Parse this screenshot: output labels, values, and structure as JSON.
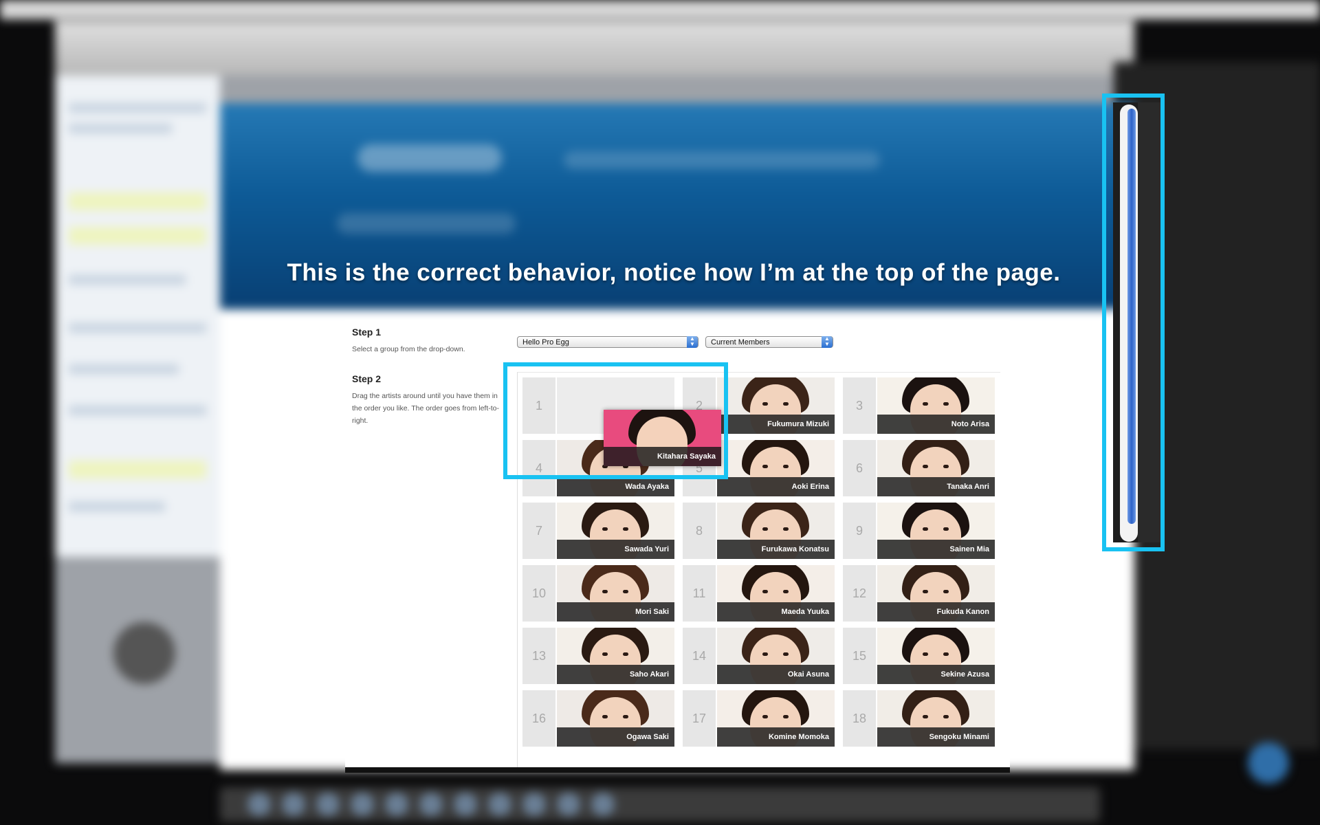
{
  "caption": "This is the correct behavior, notice how I’m at the top of the page.",
  "steps": {
    "step1": {
      "title": "Step 1",
      "text": "Select a group from the drop-down."
    },
    "step2": {
      "title": "Step 2",
      "text": "Drag the artists around until you have them in the order you like. The order goes from left-to-right."
    }
  },
  "selects": {
    "group": "Hello Pro Egg",
    "members": "Current Members"
  },
  "dragged": {
    "name": "Kitahara Sayaka"
  },
  "slots": [
    {
      "num": "1",
      "name": ""
    },
    {
      "num": "2",
      "name": "Fukumura Mizuki"
    },
    {
      "num": "3",
      "name": "Noto Arisa"
    },
    {
      "num": "4",
      "name": "Wada Ayaka"
    },
    {
      "num": "5",
      "name": "Aoki Erina"
    },
    {
      "num": "6",
      "name": "Tanaka Anri"
    },
    {
      "num": "7",
      "name": "Sawada Yuri"
    },
    {
      "num": "8",
      "name": "Furukawa Konatsu"
    },
    {
      "num": "9",
      "name": "Sainen Mia"
    },
    {
      "num": "10",
      "name": "Mori Saki"
    },
    {
      "num": "11",
      "name": "Maeda Yuuka"
    },
    {
      "num": "12",
      "name": "Fukuda Kanon"
    },
    {
      "num": "13",
      "name": "Saho Akari"
    },
    {
      "num": "14",
      "name": "Okai Asuna"
    },
    {
      "num": "15",
      "name": "Sekine Azusa"
    },
    {
      "num": "16",
      "name": "Ogawa Saki"
    },
    {
      "num": "17",
      "name": "Komine Momoka"
    },
    {
      "num": "18",
      "name": "Sengoku Minami"
    }
  ],
  "colors": {
    "highlight": "#19c2f2",
    "banner": "#0d5a96",
    "scroll_thumb": "#2d62c8"
  }
}
